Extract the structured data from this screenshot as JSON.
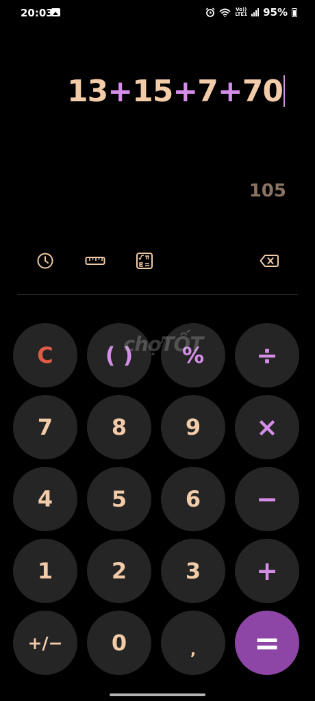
{
  "status_bar": {
    "time": "20:03",
    "battery": "95%",
    "volte_line1": "Vo))",
    "volte_line2": "LTE1",
    "icons": [
      "gallery-icon",
      "alarm-icon",
      "wifi-icon",
      "volte-icon",
      "signal-icon",
      "battery-icon"
    ]
  },
  "display": {
    "expression_parts": [
      {
        "text": "13",
        "kind": "num"
      },
      {
        "text": "+",
        "kind": "op"
      },
      {
        "text": "15",
        "kind": "num"
      },
      {
        "text": "+",
        "kind": "op"
      },
      {
        "text": "7",
        "kind": "num"
      },
      {
        "text": "+",
        "kind": "op"
      },
      {
        "text": "70",
        "kind": "num"
      }
    ],
    "result": "105"
  },
  "tools": {
    "icons": [
      "history-icon",
      "ruler-icon",
      "scientific-icon",
      "backspace-icon"
    ]
  },
  "watermark": "chợTỐT",
  "keypad": [
    {
      "label": "C",
      "name": "clear-button",
      "cls": "clear"
    },
    {
      "label": "( )",
      "name": "parentheses-button",
      "cls": "paren"
    },
    {
      "label": "%",
      "name": "percent-button",
      "cls": "percent"
    },
    {
      "label": "÷",
      "name": "divide-button",
      "cls": "op-key"
    },
    {
      "label": "7",
      "name": "digit-7-button",
      "cls": ""
    },
    {
      "label": "8",
      "name": "digit-8-button",
      "cls": ""
    },
    {
      "label": "9",
      "name": "digit-9-button",
      "cls": ""
    },
    {
      "label": "×",
      "name": "multiply-button",
      "cls": "op-key"
    },
    {
      "label": "4",
      "name": "digit-4-button",
      "cls": ""
    },
    {
      "label": "5",
      "name": "digit-5-button",
      "cls": ""
    },
    {
      "label": "6",
      "name": "digit-6-button",
      "cls": ""
    },
    {
      "label": "−",
      "name": "subtract-button",
      "cls": "op-key"
    },
    {
      "label": "1",
      "name": "digit-1-button",
      "cls": ""
    },
    {
      "label": "2",
      "name": "digit-2-button",
      "cls": ""
    },
    {
      "label": "3",
      "name": "digit-3-button",
      "cls": ""
    },
    {
      "label": "+",
      "name": "add-button",
      "cls": "op-key"
    },
    {
      "label": "+/−",
      "name": "sign-toggle-button",
      "cls": "sign"
    },
    {
      "label": "0",
      "name": "digit-0-button",
      "cls": ""
    },
    {
      "label": ",",
      "name": "decimal-button",
      "cls": "decimal"
    },
    {
      "label": "=",
      "name": "equals-button",
      "cls": "equals"
    }
  ],
  "colors": {
    "background": "#000000",
    "key_background": "#252525",
    "digit_text": "#f2cba8",
    "operator_text": "#d48ee8",
    "clear_text": "#dd5b47",
    "equals_background": "#8e46a6",
    "result_text": "#8a7362"
  }
}
